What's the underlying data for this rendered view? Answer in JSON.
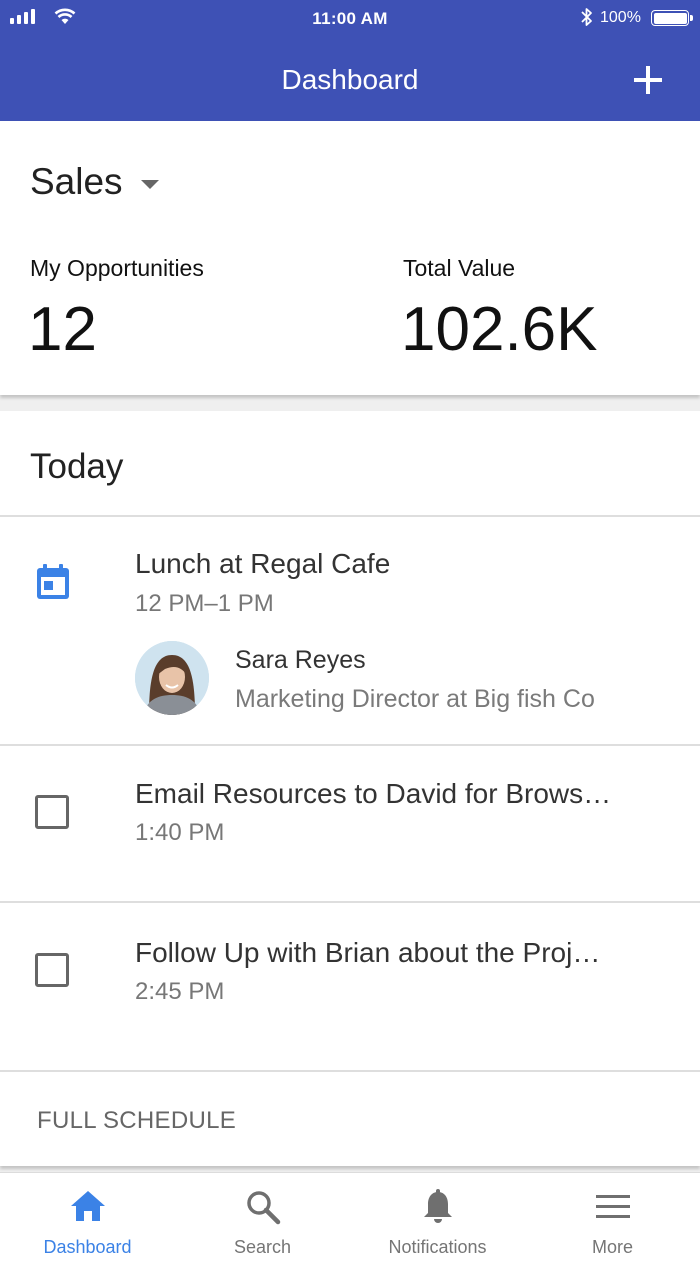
{
  "status_bar": {
    "time": "11:00 AM",
    "battery": "100%"
  },
  "app_bar": {
    "title": "Dashboard"
  },
  "sales": {
    "title": "Sales",
    "metrics": [
      {
        "label": "My Opportunities",
        "value": "12"
      },
      {
        "label": "Total Value",
        "value": "102.6K"
      }
    ]
  },
  "today": {
    "title": "Today",
    "event": {
      "title": "Lunch at Regal Cafe",
      "time": "12 PM–1 PM",
      "contact": {
        "name": "Sara Reyes",
        "role": "Marketing Director at Big fish Co"
      }
    },
    "tasks": [
      {
        "title": "Email Resources to David for Brows…",
        "time": "1:40 PM",
        "checked": false
      },
      {
        "title": "Follow Up with Brian about the Proj…",
        "time": "2:45 PM",
        "checked": false
      }
    ],
    "full_schedule": "FULL SCHEDULE"
  },
  "bottom_nav": [
    {
      "label": "Dashboard",
      "icon": "home-icon",
      "active": true
    },
    {
      "label": "Search",
      "icon": "search-icon",
      "active": false
    },
    {
      "label": "Notifications",
      "icon": "bell-icon",
      "active": false
    },
    {
      "label": "More",
      "icon": "menu-icon",
      "active": false
    }
  ],
  "colors": {
    "primary": "#3e51b5",
    "accent": "#3b82e6"
  }
}
